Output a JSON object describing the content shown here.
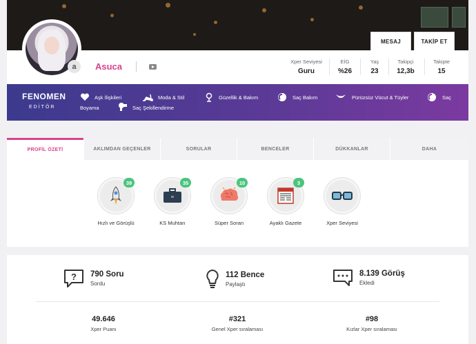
{
  "cover_buttons": {
    "message": "MESAJ",
    "follow": "TAKİP ET"
  },
  "profile": {
    "badge_letter": "a",
    "username": "Asuca",
    "social_icon": "youtube-icon"
  },
  "stats": [
    {
      "label": "Xper Seviyesi",
      "value": "Guru"
    },
    {
      "label": "EİG",
      "value": "%26"
    },
    {
      "label": "Yaş",
      "value": "23"
    },
    {
      "label": "Takipçi",
      "value": "12,3b"
    },
    {
      "label": "Takipte",
      "value": "15"
    }
  ],
  "role": {
    "title": "FENOMEN",
    "subtitle": "EDİTÖR"
  },
  "categories": [
    {
      "label": "Aşk İlişkileri",
      "icon": "heart-icon"
    },
    {
      "label": "Moda & Stil",
      "icon": "heel-icon"
    },
    {
      "label": "Güzellik & Bakım",
      "icon": "mirror-icon"
    },
    {
      "label": "Saç Bakım",
      "icon": "hair-icon"
    },
    {
      "label": "Pürüzsüz Vücut & Tüyler",
      "icon": "razor-icon"
    },
    {
      "label": "Saç",
      "icon": "hair-icon"
    },
    {
      "label": "Boyama",
      "icon": ""
    },
    {
      "label": "Saç Şekillendirme",
      "icon": "dryer-icon"
    }
  ],
  "tabs": [
    "PROFİL ÖZETİ",
    "AKLIMDAN GEÇENLER",
    "SORULAR",
    "BENCELER",
    "DÜKKANLAR",
    "DAHA"
  ],
  "badges": [
    {
      "label": "Hızlı ve Görüşlü",
      "count": "39",
      "icon": "rocket-icon"
    },
    {
      "label": "KS Muhtarı",
      "count": "35",
      "icon": "briefcase-icon"
    },
    {
      "label": "Süper Soran",
      "count": "10",
      "icon": "brain-icon"
    },
    {
      "label": "Ayaklı Gazete",
      "count": "3",
      "icon": "newspaper-icon"
    },
    {
      "label": "Xper Seviyesi",
      "count": "",
      "icon": "glasses-icon"
    }
  ],
  "activity": [
    {
      "value": "790 Soru",
      "label": "Sordu",
      "icon": "question-icon"
    },
    {
      "value": "112 Bence",
      "label": "Paylaştı",
      "icon": "lightbulb-icon"
    },
    {
      "value": "8.139 Görüş",
      "label": "Ekledi",
      "icon": "chat-icon"
    }
  ],
  "ranks": [
    {
      "value": "49.646",
      "label": "Xper Puanı"
    },
    {
      "value": "#321",
      "label": "Genel Xper sıralaması"
    },
    {
      "value": "#98",
      "label": "Kızlar Xper sıralaması"
    }
  ],
  "colors": {
    "accent": "#d9428c",
    "band_start": "#3c3a8e",
    "band_end": "#7b3aa0",
    "badge_green": "#4cc47e"
  }
}
